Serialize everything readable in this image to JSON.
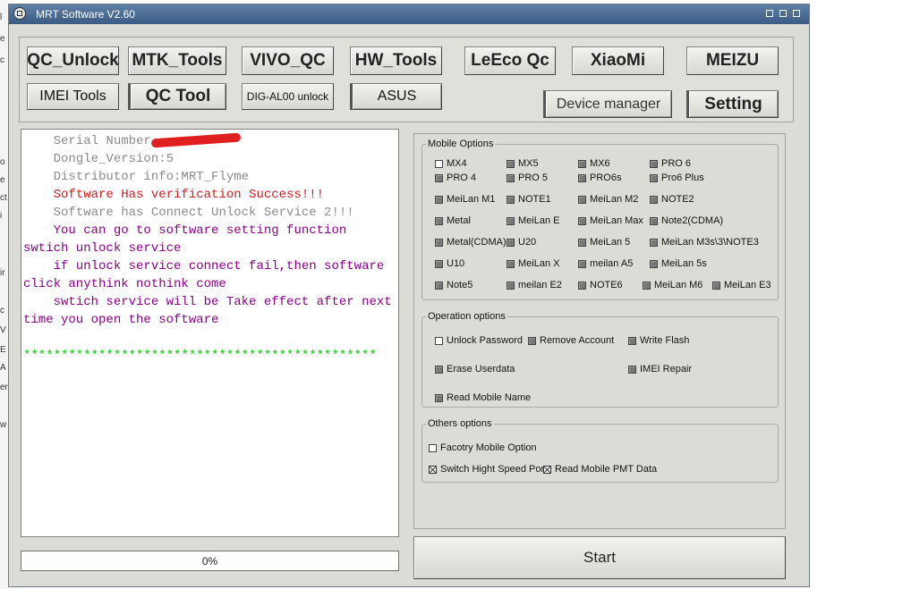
{
  "window": {
    "title": "MRT Software V2.60"
  },
  "edge_letters": [
    "l",
    "e",
    "c",
    "o",
    "e",
    "ct",
    "i",
    "ir",
    "c",
    "V",
    "E",
    "A",
    "er",
    "w"
  ],
  "toolbar": {
    "row1": [
      "QC_Unlock",
      "MTK_Tools",
      "VIVO_QC",
      "HW_Tools",
      "LeEco Qc",
      "XiaoMi",
      "MEIZU"
    ],
    "row2": [
      "IMEI Tools",
      "QC Tool",
      "DIG-AL00 unlock",
      "ASUS",
      "Device manager",
      "Setting"
    ]
  },
  "log": {
    "lines": [
      {
        "text": "    Serial Number",
        "color": "gray"
      },
      {
        "text": "    Dongle_Version:5",
        "color": "gray"
      },
      {
        "text": "    Distributor info:MRT_Flyme",
        "color": "gray"
      },
      {
        "text": "    Software Has verification Success!!!",
        "color": "red"
      },
      {
        "text": "    Software has Connect Unlock Service 2!!!",
        "color": "gray"
      },
      {
        "text": "    You can go to software setting function swtich unlock service",
        "color": "purple"
      },
      {
        "text": "    if unlock service connect fail,then software click anythink nothink come",
        "color": "purple"
      },
      {
        "text": "    swtich service will be Take effect after next time you open the software",
        "color": "purple"
      },
      {
        "text": "    ***********************************************",
        "color": "green"
      }
    ]
  },
  "progress": {
    "label": "0%",
    "value": 0
  },
  "mobile_options": {
    "legend": "Mobile Options",
    "items": [
      "MX4",
      "MX5",
      "MX6",
      "PRO 6",
      "PRO 4",
      "PRO 5",
      "PRO6s",
      "Pro6 Plus",
      "MeiLan M1",
      "NOTE1",
      "MeiLan M2",
      "NOTE2",
      "Metal",
      "MeiLan E",
      "MeiLan Max",
      "Note2(CDMA)",
      "Metal(CDMA)",
      "U20",
      "MeiLan 5",
      "MeiLan M3s\\3\\NOTE3",
      "U10",
      "MeiLan X",
      "meilan A5",
      "MeiLan 5s",
      "Note5",
      "meilan E2",
      "NOTE6",
      "MeiLan M6",
      "MeiLan E3"
    ]
  },
  "operation_options": {
    "legend": "Operation options",
    "items": [
      "Unlock Password",
      "Remove Account",
      "Write Flash",
      "Erase Userdata",
      "IMEI Repair",
      "Read Mobile Name"
    ]
  },
  "others_options": {
    "legend": "Others options",
    "items": [
      "Facotry Mobile Option",
      "Switch Hight Speed Por",
      "Read Mobile PMT Data"
    ]
  },
  "start_button": {
    "label": "Start"
  }
}
